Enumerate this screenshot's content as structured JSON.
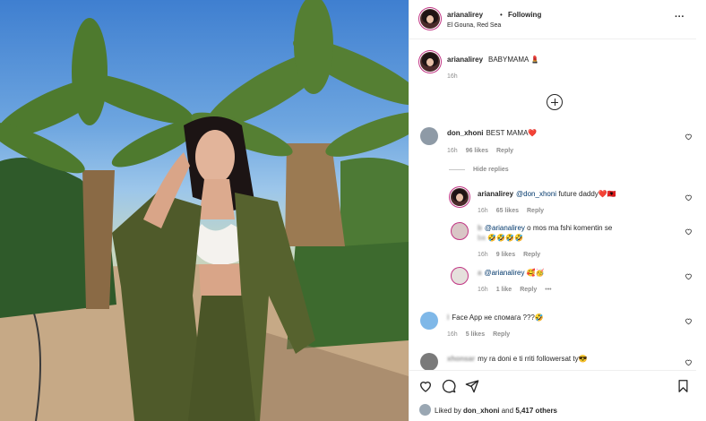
{
  "post": {
    "username": "arianalirey",
    "separator": "•",
    "follow_status": "Following",
    "location": "El Gouna, Red Sea",
    "more_icon": "more-horizontal-icon"
  },
  "caption": {
    "username": "arianalirey",
    "text": "BABYMAMA 💄",
    "time": "16h"
  },
  "load_more_icon": "plus-circle-icon",
  "comments": [
    {
      "username": "don_xhoni",
      "text": "BEST MAMA❤️",
      "time": "16h",
      "likes": "96 likes",
      "reply": "Reply"
    },
    {
      "username": "arianalirey",
      "mention": "@don_xhoni",
      "text": "future daddy❤️🇦🇱",
      "time": "16h",
      "likes": "65 likes",
      "reply": "Reply"
    },
    {
      "username": "b",
      "mention": "@arianalirey",
      "text": "o mos ma fshi komentin se",
      "text2": "ba",
      "emoji": "🤣🤣🤣🤣",
      "time": "16h",
      "likes": "9 likes",
      "reply": "Reply"
    },
    {
      "username": "a",
      "mention": "@arianalirey",
      "text": "🥰🥳",
      "time": "16h",
      "likes": "1 like",
      "reply": "Reply",
      "more": "•••"
    },
    {
      "username": "l",
      "text": "Face App не спомага ???🤣",
      "time": "16h",
      "likes": "5 likes",
      "reply": "Reply"
    },
    {
      "username": "xhonsar",
      "text": "my ra doni e ti rriti followersat ty😎"
    }
  ],
  "hide_replies": "Hide replies",
  "liked_by": {
    "prefix": "Liked by",
    "user": "don_xhoni",
    "and": "and",
    "count": "5,417 others"
  },
  "icons": [
    "heart-icon",
    "comment-icon",
    "share-icon",
    "bookmark-icon"
  ],
  "colors": {
    "mention": "#00376b",
    "muted": "#8e8e8e",
    "text": "#262626",
    "story_ring": "#c13584"
  }
}
